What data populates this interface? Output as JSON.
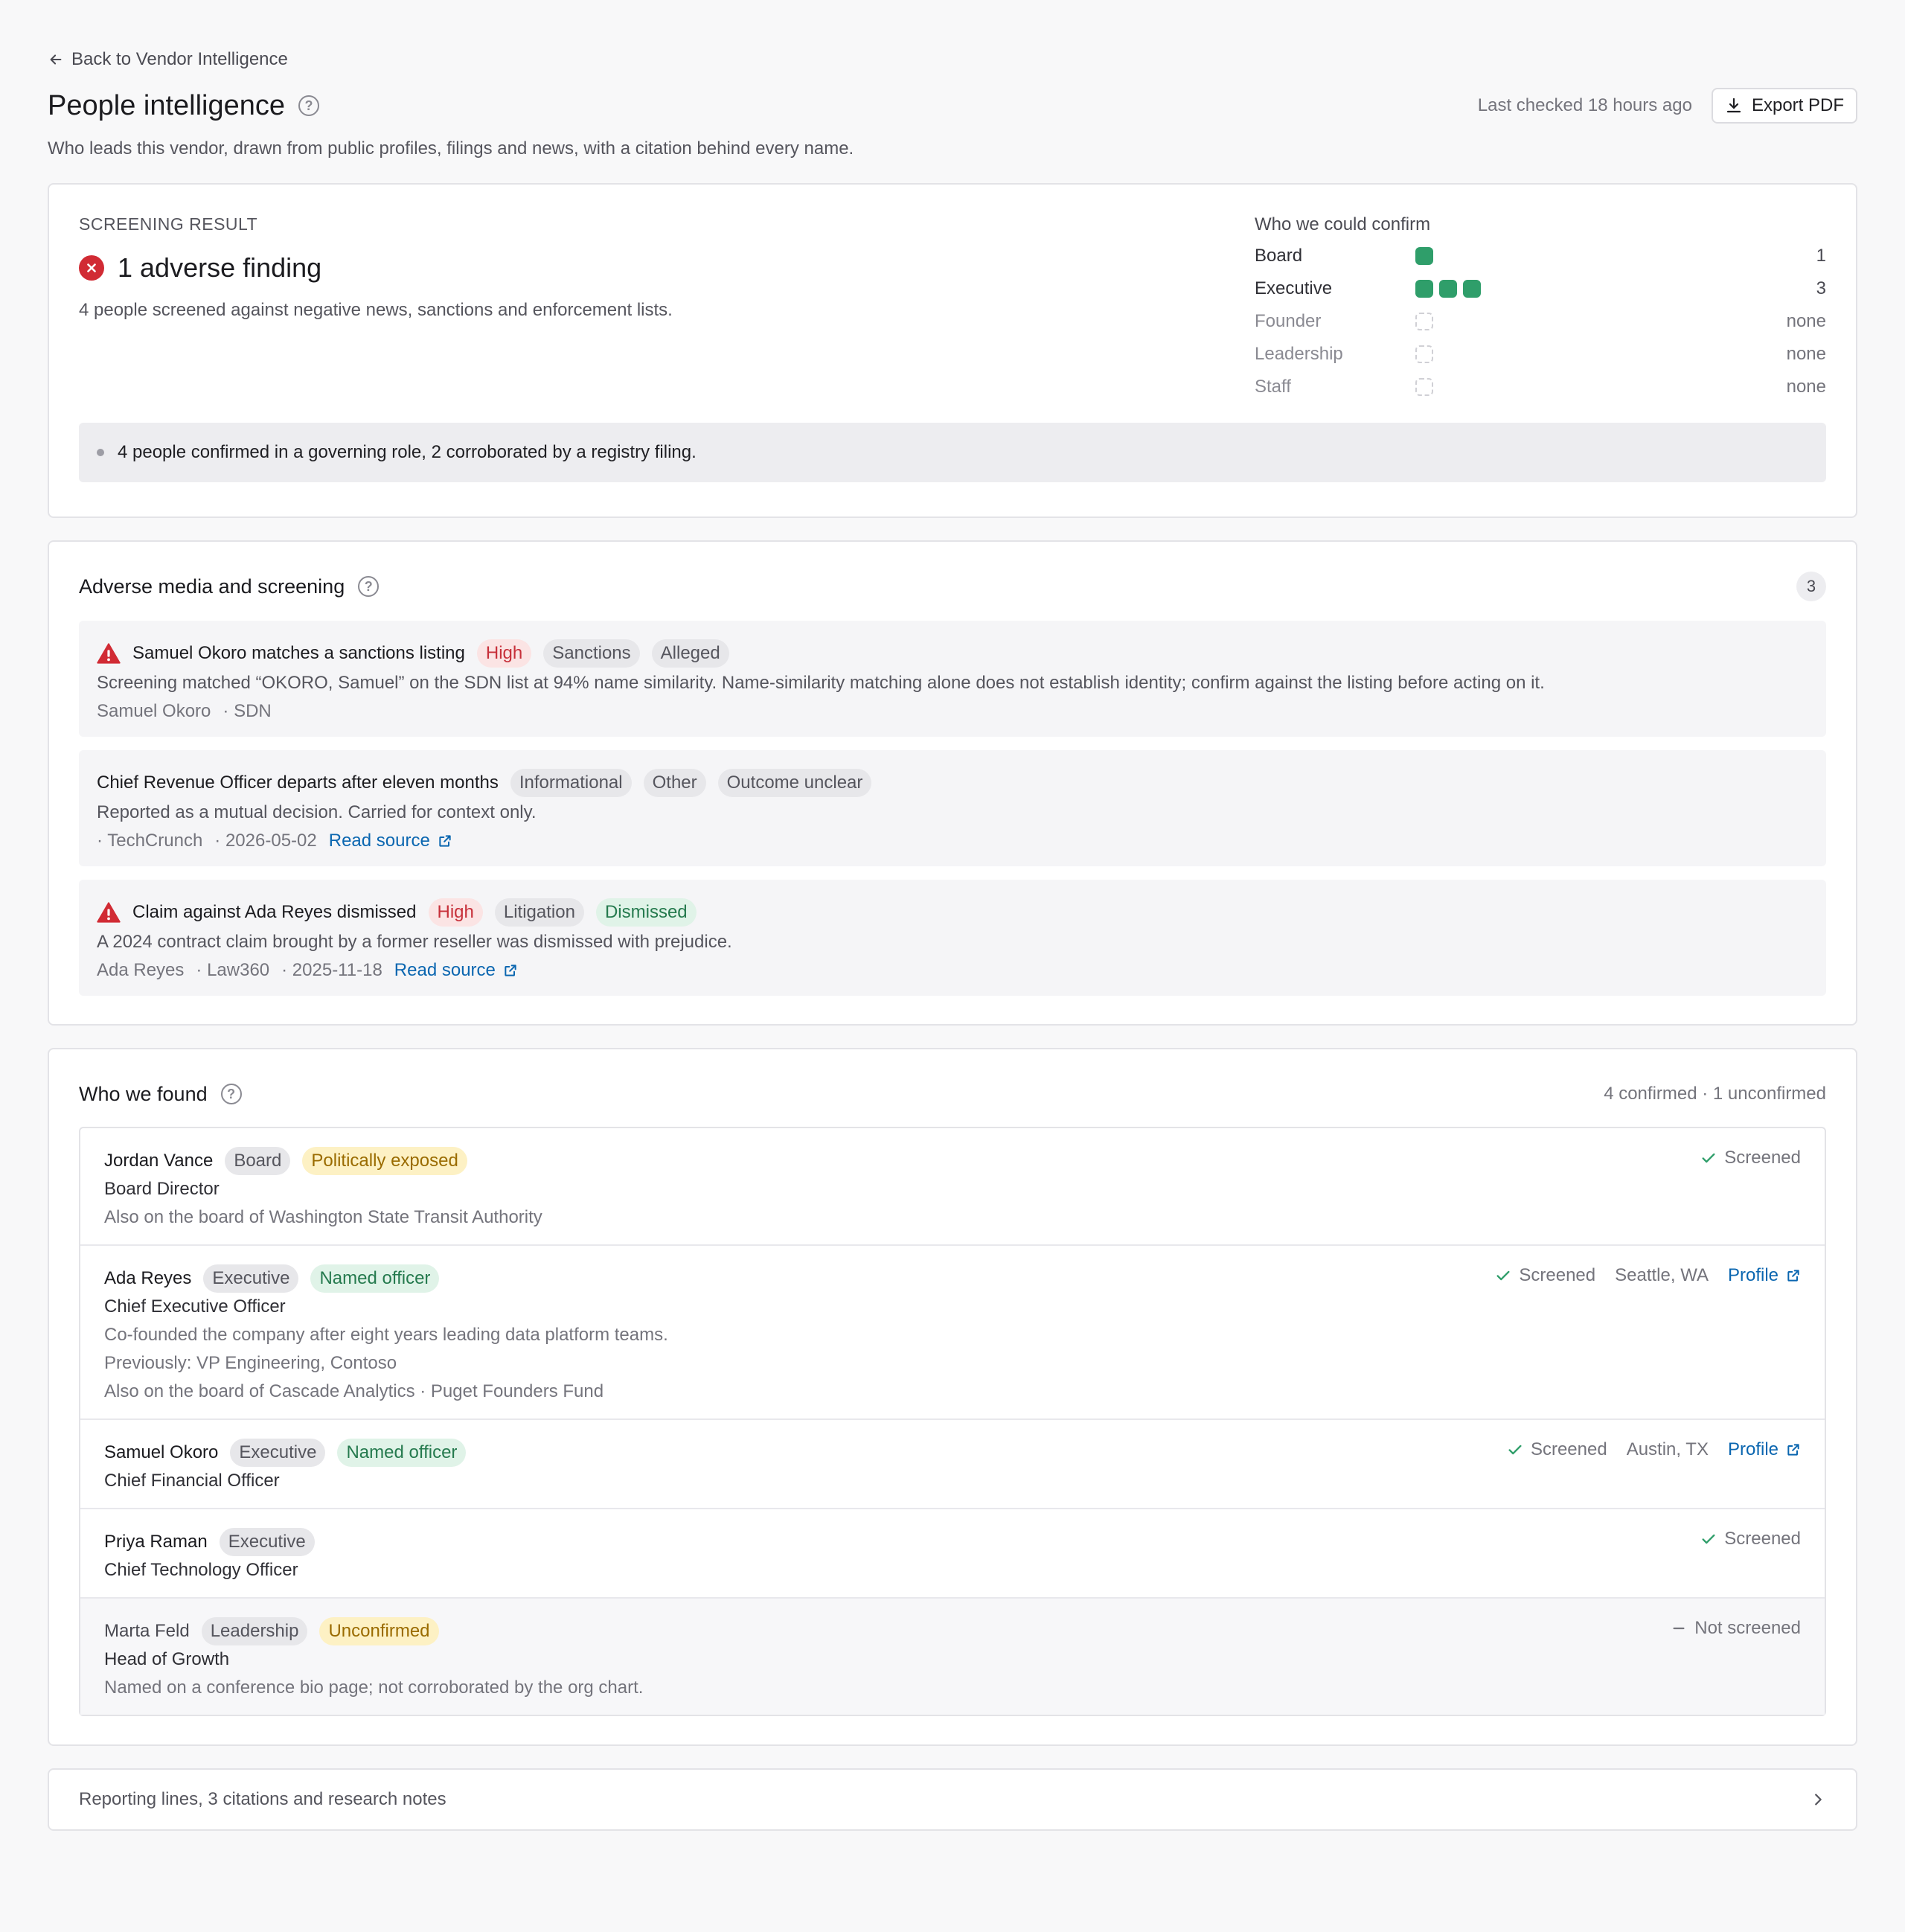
{
  "nav": {
    "back_label": "Back to Vendor Intelligence"
  },
  "header": {
    "title": "People intelligence",
    "last_checked": "Last checked 18 hours ago",
    "export_label": "Export PDF",
    "subtitle": "Who leads this vendor, drawn from public profiles, filings and news, with a citation behind every name."
  },
  "screening": {
    "overline": "SCREENING RESULT",
    "finding": "1 adverse finding",
    "description": "4 people screened against negative news, sanctions and enforcement lists.",
    "confirm_title": "Who we could confirm",
    "roles": [
      {
        "label": "Board",
        "count": 1,
        "value": "1"
      },
      {
        "label": "Executive",
        "count": 3,
        "value": "3"
      },
      {
        "label": "Founder",
        "count": 0,
        "value": "none"
      },
      {
        "label": "Leadership",
        "count": 0,
        "value": "none"
      },
      {
        "label": "Staff",
        "count": 0,
        "value": "none"
      }
    ],
    "summary": "4 people confirmed in a governing role, 2 corroborated by a registry filing."
  },
  "adverse": {
    "title": "Adverse media and screening",
    "count": "3",
    "items": [
      {
        "title": "Samuel Okoro matches a sanctions listing",
        "tags": [
          "High",
          "Sanctions",
          "Alleged"
        ],
        "description": "Screening matched “OKORO, Samuel” on the SDN list at 94% name similarity. Name-similarity matching alone does not establish identity; confirm against the listing before acting on it.",
        "meta": [
          "Samuel Okoro",
          "· SDN"
        ]
      },
      {
        "title": "Chief Revenue Officer departs after eleven months",
        "tags": [
          "Informational",
          "Other",
          "Outcome unclear"
        ],
        "description": "Reported as a mutual decision. Carried for context only.",
        "meta": [
          "· TechCrunch",
          "· 2026-05-02"
        ],
        "link": "Read source"
      },
      {
        "title": "Claim against Ada Reyes dismissed",
        "tags": [
          "High",
          "Litigation",
          "Dismissed"
        ],
        "description": "A 2024 contract claim brought by a former reseller was dismissed with prejudice.",
        "meta": [
          "Ada Reyes",
          "· Law360",
          "· 2025-11-18"
        ],
        "link": "Read source"
      }
    ]
  },
  "found": {
    "title": "Who we found",
    "count": "4 confirmed · 1 unconfirmed",
    "people": [
      {
        "name": "Jordan Vance",
        "tags": [
          "Board",
          "Politically exposed"
        ],
        "role": "Board Director",
        "lines": [
          "Also on the board of Washington State Transit Authority"
        ],
        "status": "Screened"
      },
      {
        "name": "Ada Reyes",
        "tags": [
          "Executive",
          "Named officer"
        ],
        "role": "Chief Executive Officer",
        "lines": [
          "Co-founded the company after eight years leading data platform teams.",
          "Previously: VP Engineering, Contoso",
          "Also on the board of Cascade Analytics · Puget Founders Fund"
        ],
        "status": "Screened",
        "location": "Seattle, WA",
        "profile": "Profile"
      },
      {
        "name": "Samuel Okoro",
        "tags": [
          "Executive",
          "Named officer"
        ],
        "role": "Chief Financial Officer",
        "status": "Screened",
        "location": "Austin, TX",
        "profile": "Profile"
      },
      {
        "name": "Priya Raman",
        "tags": [
          "Executive"
        ],
        "role": "Chief Technology Officer",
        "status": "Screened"
      },
      {
        "name": "Marta Feld",
        "tags": [
          "Leadership",
          "Unconfirmed"
        ],
        "role": "Head of Growth",
        "lines": [
          "Named on a conference bio page; not corroborated by the org chart."
        ],
        "status": "Not screened"
      }
    ]
  },
  "footer": {
    "label": "Reporting lines, 3 citations and research notes"
  },
  "colors": {
    "accent_green": "#2f9e6a",
    "danger": "#d12b34",
    "link": "#0a66b0"
  }
}
